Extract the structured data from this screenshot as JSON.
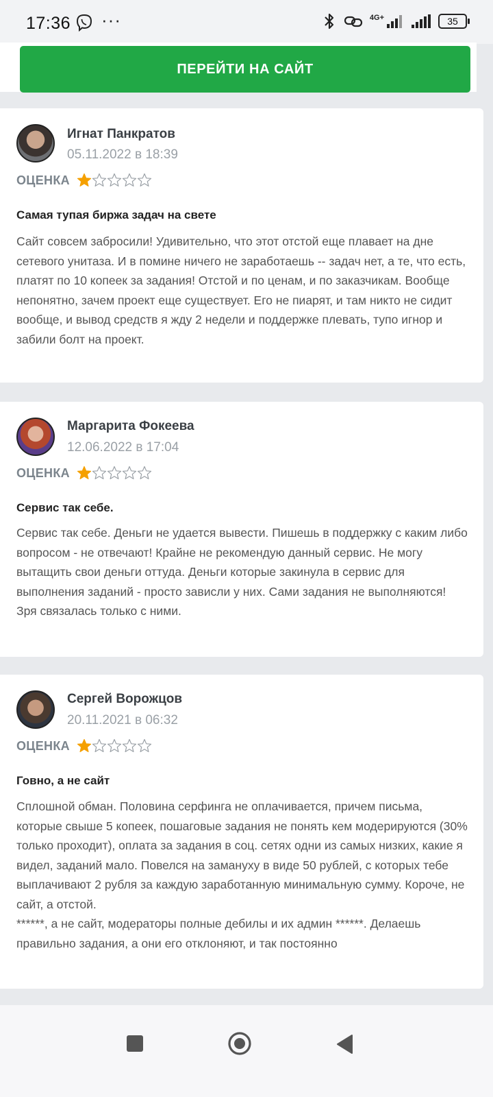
{
  "status_bar": {
    "time": "17:36",
    "dots": "···",
    "network": "4G+",
    "battery": "35"
  },
  "cta": {
    "label": "ПЕРЕЙТИ НА САЙТ",
    "color": "#21a846"
  },
  "rating_label": "ОЦЕНКА",
  "star_color": "#f5a000",
  "reviews": [
    {
      "author": "Игнат Панкратов",
      "date": "05.11.2022 в 18:39",
      "rating": 1,
      "max_rating": 5,
      "title": "Самая тупая биржа задач на свете",
      "body": [
        "Сайт совсем забросили! Удивительно, что этот отстой еще плавает на дне сетевого унитаза. И в помине ничего не заработаешь -- задач нет, а те, что есть, платят по 10 копеек за задания! Отстой и по ценам, и по заказчикам. Вообще непонятно, зачем проект еще существует. Его не пиарят, и там никто не сидит вообще, и вывод средств я жду 2 недели и поддержке плевать, тупо игнор и забили болт на проект."
      ]
    },
    {
      "author": "Маргарита Фокеева",
      "date": "12.06.2022 в 17:04",
      "rating": 1,
      "max_rating": 5,
      "title": "Сервис так себе.",
      "body": [
        "Сервис так себе. Деньги не удается вывести. Пишешь в поддержку с каким либо вопросом - не отвечают! Крайне не рекомендую данный сервис. Не могу вытащить свои деньги оттуда. Деньги которые закинула в сервис для выполнения заданий - просто зависли у них. Сами задания не выполняются! Зря связалась только с ними."
      ]
    },
    {
      "author": "Сергей Ворожцов",
      "date": "20.11.2021 в 06:32",
      "rating": 1,
      "max_rating": 5,
      "title": "Говно, а не сайт",
      "body": [
        "Сплошной обман. Половина серфинга не оплачивается, причем письма, которые свыше 5 копеек, пошаговые задания не понять кем модерируются (30% только проходит), оплата за задания в соц. сетях одни из самых низких, какие я видел, заданий мало. Повелся на замануху в виде 50 рублей, с которых тебе выплачивают 2 рубля за каждую заработанную минимальную сумму. Короче, не сайт, а отстой.",
        "******, а не сайт, модераторы полные дебилы и их админ ******. Делаешь правильно задания, а они его отклоняют, и так постоянно"
      ]
    }
  ]
}
